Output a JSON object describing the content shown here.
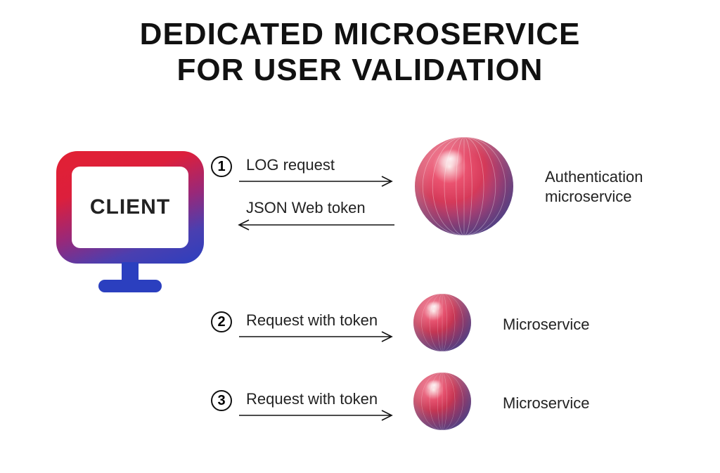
{
  "title_line1": "DEDICATED MICROSERVICE",
  "title_line2": "FOR USER VALIDATION",
  "client_label": "CLIENT",
  "steps": {
    "step1_num": "1",
    "step1_top_label": "LOG request",
    "step1_bottom_label": "JSON Web token",
    "step2_num": "2",
    "step2_label": "Request with token",
    "step3_num": "3",
    "step3_label": "Request with token"
  },
  "nodes": {
    "auth_label_line1": "Authentication",
    "auth_label_line2": "microservice",
    "ms2_label": "Microservice",
    "ms3_label": "Microservice"
  },
  "colors": {
    "gradient_start": "#e22033",
    "gradient_end": "#2c3fbf"
  }
}
